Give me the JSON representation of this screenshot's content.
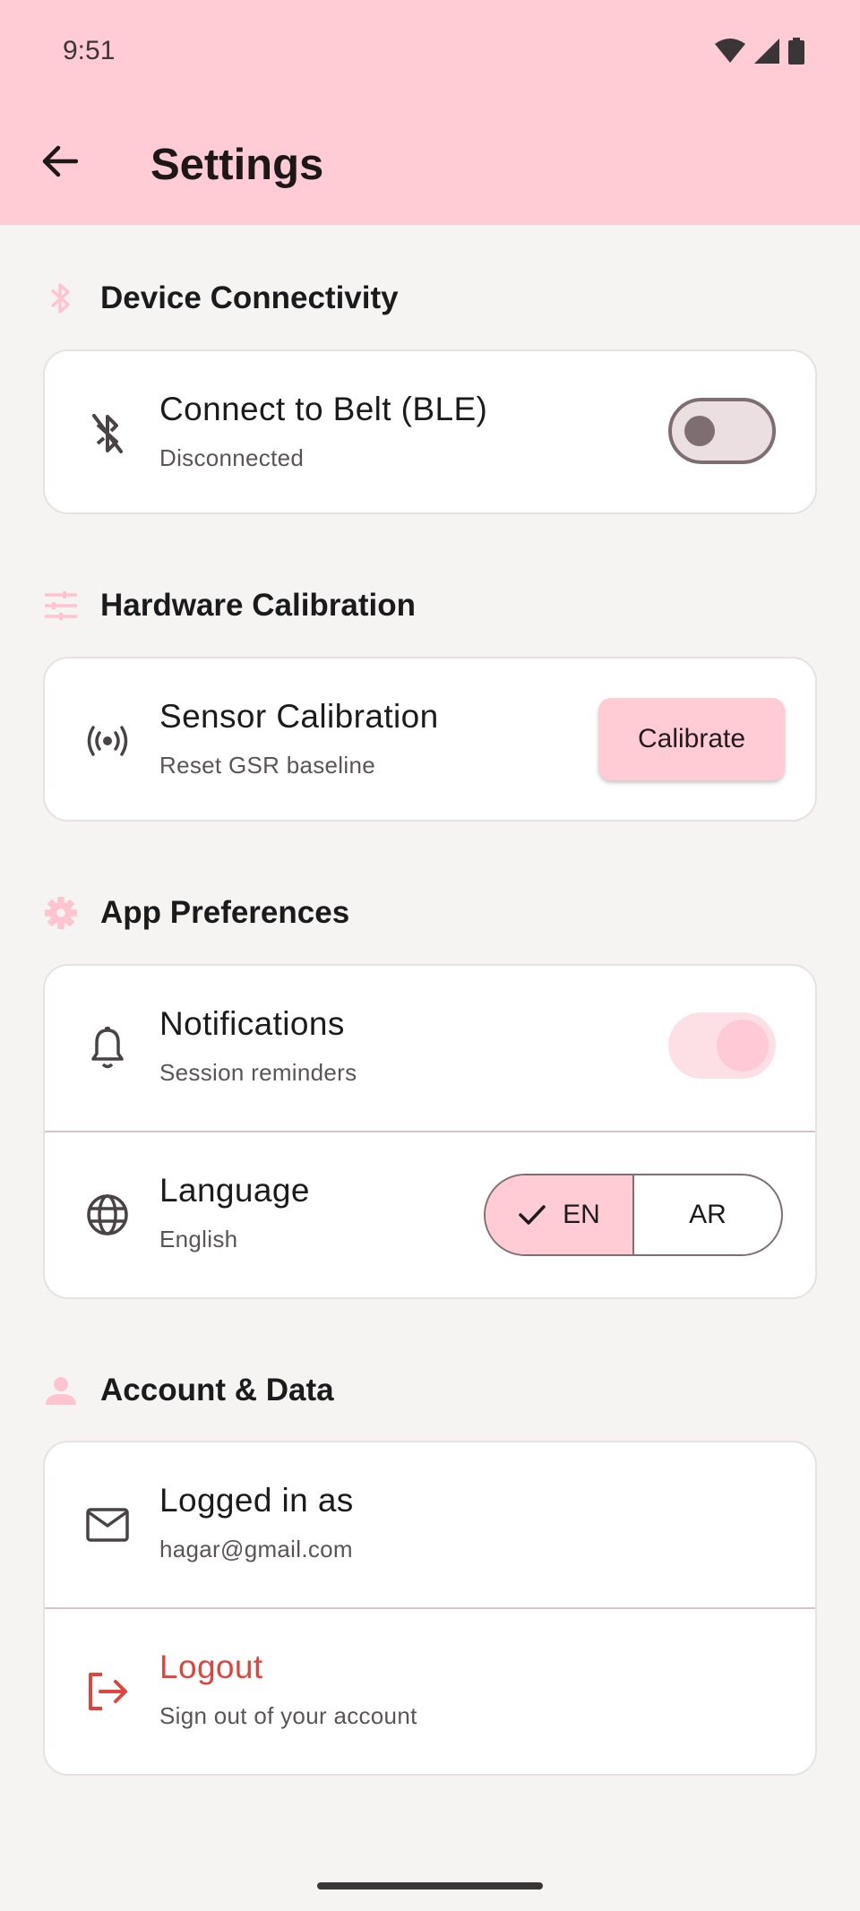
{
  "status_bar": {
    "time": "9:51"
  },
  "app_bar": {
    "title": "Settings"
  },
  "sections": {
    "device": {
      "title": "Device Connectivity",
      "connect": {
        "title": "Connect to Belt (BLE)",
        "subtitle": "Disconnected",
        "toggle_on": false
      }
    },
    "hardware": {
      "title": "Hardware Calibration",
      "sensor": {
        "title": "Sensor Calibration",
        "subtitle": "Reset GSR baseline",
        "button_label": "Calibrate"
      }
    },
    "preferences": {
      "title": "App Preferences",
      "notifications": {
        "title": "Notifications",
        "subtitle": "Session reminders",
        "toggle_on": true
      },
      "language": {
        "title": "Language",
        "subtitle": "English",
        "options": [
          "EN",
          "AR"
        ],
        "selected": "EN"
      }
    },
    "account": {
      "title": "Account & Data",
      "logged_in": {
        "title": "Logged in as",
        "subtitle": "hagar@gmail.com"
      },
      "logout": {
        "title": "Logout",
        "subtitle": "Sign out of your account"
      }
    }
  },
  "colors": {
    "app_bar": "#ffccd6",
    "accent": "#ffccd6",
    "section_icon": "#ffc4d0",
    "logout": "#e0453d",
    "background": "#f6f4f3"
  }
}
